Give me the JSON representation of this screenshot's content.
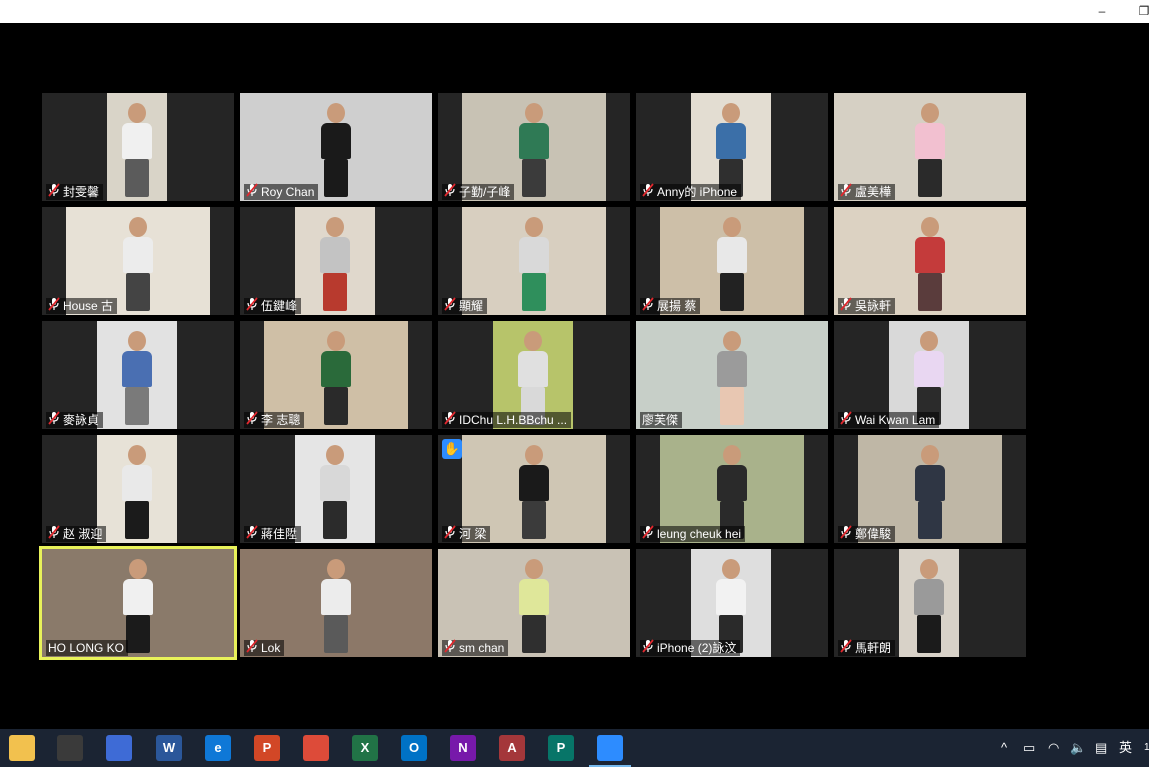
{
  "window": {
    "minimize_glyph": "–",
    "restore_glyph": "❐"
  },
  "participants": [
    {
      "name": "封雯馨",
      "muted": true
    },
    {
      "name": "Roy Chan",
      "muted": true
    },
    {
      "name": "子勤/子峰",
      "muted": true
    },
    {
      "name": "Anny的 iPhone",
      "muted": true
    },
    {
      "name": "盧美樺",
      "muted": true
    },
    {
      "name": "House 古",
      "muted": true
    },
    {
      "name": "伍鍵峰",
      "muted": true
    },
    {
      "name": "顯耀",
      "muted": true
    },
    {
      "name": "展揚 蔡",
      "muted": true
    },
    {
      "name": "吳詠軒",
      "muted": true
    },
    {
      "name": "麥詠貞",
      "muted": true
    },
    {
      "name": "李 志聰",
      "muted": true
    },
    {
      "name": "IDChu L.H.BBchu ...",
      "muted": true
    },
    {
      "name": "廖芙傑",
      "muted": false
    },
    {
      "name": "Wai Kwan Lam",
      "muted": true
    },
    {
      "name": "赵 淑迎",
      "muted": true
    },
    {
      "name": "蔣佳陞",
      "muted": true
    },
    {
      "name": "河 梁",
      "muted": true,
      "hand_raised": true
    },
    {
      "name": "leung cheuk  hei",
      "muted": true
    },
    {
      "name": "鄭偉駿",
      "muted": true
    },
    {
      "name": "HO LONG KO",
      "muted": false,
      "active_speaker": true
    },
    {
      "name": "Lok",
      "muted": true
    },
    {
      "name": "sm chan",
      "muted": true
    },
    {
      "name": "iPhone (2)詠汶",
      "muted": true
    },
    {
      "name": "馬軒朗",
      "muted": true
    }
  ],
  "taskbar": {
    "apps": [
      {
        "name": "file-explorer",
        "glyph": "",
        "color": "#f2c14e"
      },
      {
        "name": "store",
        "glyph": "",
        "color": "#3a3a3a"
      },
      {
        "name": "calculator",
        "glyph": "",
        "color": "#3e6bd6"
      },
      {
        "name": "word",
        "glyph": "W",
        "color": "#2b579a"
      },
      {
        "name": "edge",
        "glyph": "e",
        "color": "#0f78d7"
      },
      {
        "name": "powerpoint",
        "glyph": "P",
        "color": "#d24726"
      },
      {
        "name": "chrome",
        "glyph": "",
        "color": "#dd4b39"
      },
      {
        "name": "excel",
        "glyph": "X",
        "color": "#217346"
      },
      {
        "name": "outlook",
        "glyph": "O",
        "color": "#0072c6"
      },
      {
        "name": "onenote",
        "glyph": "N",
        "color": "#7719aa"
      },
      {
        "name": "access",
        "glyph": "A",
        "color": "#a4373a"
      },
      {
        "name": "publisher",
        "glyph": "P",
        "color": "#077568"
      },
      {
        "name": "zoom",
        "glyph": "",
        "color": "#2d8cff",
        "active": true
      }
    ],
    "tray": {
      "chevron": "^",
      "ime": "英",
      "clock_fragment": "1"
    }
  },
  "colors": {
    "active_speaker_border": "#e8f25a",
    "muted_icon": "#e0282e",
    "hand_raise": "#2d8cff"
  }
}
